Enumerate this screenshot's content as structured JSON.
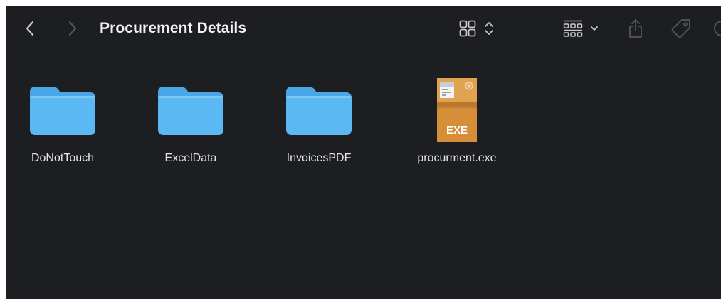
{
  "window": {
    "title": "Procurement Details"
  },
  "toolbar": {
    "back_icon": "chevron-left-icon",
    "forward_icon": "chevron-right-icon",
    "view_icon": "icon-grid-view-icon",
    "group_icon": "group-by-icon",
    "share_icon": "share-icon",
    "tag_icon": "tag-icon"
  },
  "colors": {
    "background": "#1d1e22",
    "folder_front": "#5cb8f2",
    "folder_back": "#4aa6e6",
    "exe_box": "#d9953f",
    "text": "#e6e6ea"
  },
  "files": [
    {
      "name": "DoNotTouch",
      "kind": "folder",
      "icon": "folder-icon"
    },
    {
      "name": "ExcelData",
      "kind": "folder",
      "icon": "folder-icon"
    },
    {
      "name": "InvoicesPDF",
      "kind": "folder",
      "icon": "folder-icon"
    },
    {
      "name": "procurment.exe",
      "kind": "executable",
      "icon": "exe-package-icon",
      "badge": "EXE"
    }
  ]
}
